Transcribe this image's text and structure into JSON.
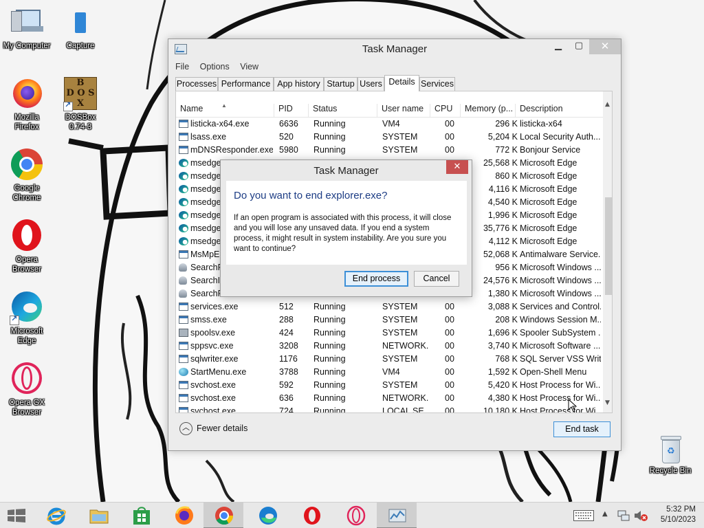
{
  "desktop": {
    "icons": [
      {
        "label": "My Computer"
      },
      {
        "label": "Capture"
      },
      {
        "label": "Mozilla\nFirefox"
      },
      {
        "label": "DOSBox\n0.74-3"
      },
      {
        "label": "Google\nChrome"
      },
      {
        "label": "Opera\nBrowser"
      },
      {
        "label": "Microsoft\nEdge"
      },
      {
        "label": "Opera GX\nBrowser"
      }
    ],
    "recycle_bin": "Recycle Bin"
  },
  "task_manager": {
    "title": "Task Manager",
    "menu": [
      "File",
      "Options",
      "View"
    ],
    "tabs": [
      "Processes",
      "Performance",
      "App history",
      "Startup",
      "Users",
      "Details",
      "Services"
    ],
    "active_tab": "Details",
    "columns": [
      "Name",
      "PID",
      "Status",
      "User name",
      "CPU",
      "Memory (p...",
      "Description"
    ],
    "rows": [
      {
        "name": "listicka-x64.exe",
        "pid": "6636",
        "status": "Running",
        "user": "VM4",
        "cpu": "00",
        "mem": "296 K",
        "desc": "listicka-x64",
        "icon": "exe"
      },
      {
        "name": "lsass.exe",
        "pid": "520",
        "status": "Running",
        "user": "SYSTEM",
        "cpu": "00",
        "mem": "5,204 K",
        "desc": "Local Security Auth...",
        "icon": "exe"
      },
      {
        "name": "mDNSResponder.exe",
        "pid": "5980",
        "status": "Running",
        "user": "SYSTEM",
        "cpu": "00",
        "mem": "772 K",
        "desc": "Bonjour Service",
        "icon": "exe"
      },
      {
        "name": "msedge.",
        "pid": "",
        "status": "",
        "user": "",
        "cpu": "",
        "mem": "25,568 K",
        "desc": "Microsoft Edge",
        "icon": "edge"
      },
      {
        "name": "msedge.",
        "pid": "",
        "status": "",
        "user": "",
        "cpu": "",
        "mem": "860 K",
        "desc": "Microsoft Edge",
        "icon": "edge"
      },
      {
        "name": "msedge.",
        "pid": "",
        "status": "",
        "user": "",
        "cpu": "",
        "mem": "4,116 K",
        "desc": "Microsoft Edge",
        "icon": "edge"
      },
      {
        "name": "msedge.",
        "pid": "",
        "status": "",
        "user": "",
        "cpu": "",
        "mem": "4,540 K",
        "desc": "Microsoft Edge",
        "icon": "edge"
      },
      {
        "name": "msedge.",
        "pid": "",
        "status": "",
        "user": "",
        "cpu": "",
        "mem": "1,996 K",
        "desc": "Microsoft Edge",
        "icon": "edge"
      },
      {
        "name": "msedge.",
        "pid": "",
        "status": "",
        "user": "",
        "cpu": "",
        "mem": "35,776 K",
        "desc": "Microsoft Edge",
        "icon": "edge"
      },
      {
        "name": "msedge.",
        "pid": "",
        "status": "",
        "user": "",
        "cpu": "",
        "mem": "4,112 K",
        "desc": "Microsoft Edge",
        "icon": "edge"
      },
      {
        "name": "MsMpEn",
        "pid": "",
        "status": "",
        "user": "",
        "cpu": "",
        "mem": "52,068 K",
        "desc": "Antimalware Service...",
        "icon": "exe"
      },
      {
        "name": "SearchFil",
        "pid": "",
        "status": "",
        "user": "",
        "cpu": "",
        "mem": "956 K",
        "desc": "Microsoft Windows ...",
        "icon": "user"
      },
      {
        "name": "SearchIn",
        "pid": "",
        "status": "",
        "user": "",
        "cpu": "",
        "mem": "24,576 K",
        "desc": "Microsoft Windows ...",
        "icon": "user"
      },
      {
        "name": "SearchPr",
        "pid": "",
        "status": "",
        "user": "",
        "cpu": "",
        "mem": "1,380 K",
        "desc": "Microsoft Windows ...",
        "icon": "user"
      },
      {
        "name": "services.exe",
        "pid": "512",
        "status": "Running",
        "user": "SYSTEM",
        "cpu": "00",
        "mem": "3,088 K",
        "desc": "Services and Control...",
        "icon": "exe"
      },
      {
        "name": "smss.exe",
        "pid": "288",
        "status": "Running",
        "user": "SYSTEM",
        "cpu": "00",
        "mem": "208 K",
        "desc": "Windows Session M...",
        "icon": "exe"
      },
      {
        "name": "spoolsv.exe",
        "pid": "424",
        "status": "Running",
        "user": "SYSTEM",
        "cpu": "00",
        "mem": "1,696 K",
        "desc": "Spooler SubSystem ...",
        "icon": "print"
      },
      {
        "name": "sppsvc.exe",
        "pid": "3208",
        "status": "Running",
        "user": "NETWORK...",
        "cpu": "00",
        "mem": "3,740 K",
        "desc": "Microsoft Software ...",
        "icon": "exe"
      },
      {
        "name": "sqlwriter.exe",
        "pid": "1176",
        "status": "Running",
        "user": "SYSTEM",
        "cpu": "00",
        "mem": "768 K",
        "desc": "SQL Server VSS Writ...",
        "icon": "exe"
      },
      {
        "name": "StartMenu.exe",
        "pid": "3788",
        "status": "Running",
        "user": "VM4",
        "cpu": "00",
        "mem": "1,592 K",
        "desc": "Open-Shell Menu",
        "icon": "globe"
      },
      {
        "name": "svchost.exe",
        "pid": "592",
        "status": "Running",
        "user": "SYSTEM",
        "cpu": "00",
        "mem": "5,420 K",
        "desc": "Host Process for Wi...",
        "icon": "exe"
      },
      {
        "name": "svchost.exe",
        "pid": "636",
        "status": "Running",
        "user": "NETWORK...",
        "cpu": "00",
        "mem": "4,380 K",
        "desc": "Host Process for Wi...",
        "icon": "exe"
      },
      {
        "name": "svchost.exe",
        "pid": "724",
        "status": "Running",
        "user": "LOCAL SE...",
        "cpu": "00",
        "mem": "10,180 K",
        "desc": "Host Process for Wi...",
        "icon": "exe"
      }
    ],
    "fewer_details": "Fewer details",
    "end_task": "End task"
  },
  "dialog": {
    "title": "Task Manager",
    "question": "Do you want to end explorer.exe?",
    "message": "If an open program is associated with this process, it will close and you will lose any unsaved data. If you end a system process, it might result in system instability. Are you sure you want to continue?",
    "end_process": "End process",
    "cancel": "Cancel"
  },
  "taskbar": {
    "clock_time": "5:32 PM",
    "clock_date": "5/10/2023"
  },
  "colors": {
    "dialog_question": "#1c3c84",
    "selected_button_border": "#3c8fd7",
    "close_button_red": "#c75050"
  }
}
